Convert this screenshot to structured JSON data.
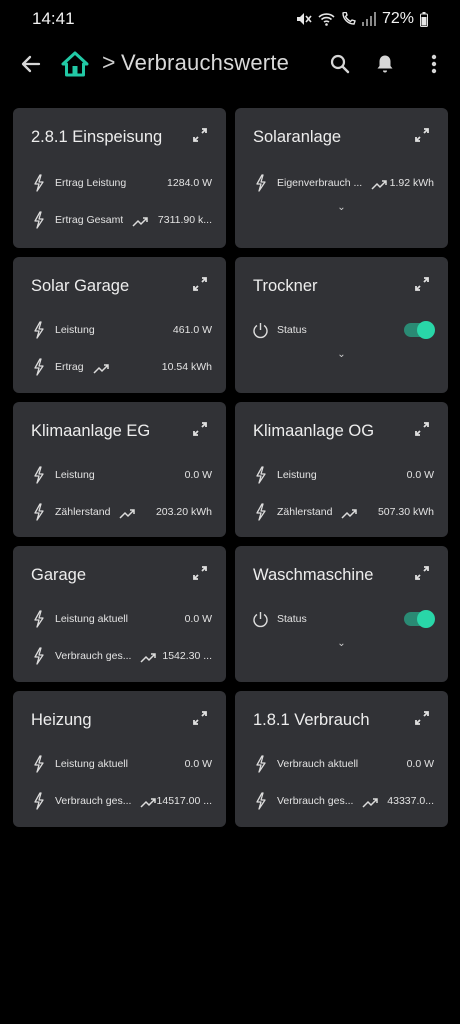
{
  "status_bar": {
    "time": "14:41",
    "battery": "72%"
  },
  "app_bar": {
    "separator": ">",
    "title": "Verbrauchswerte"
  },
  "colors": {
    "accent": "#29d6a8",
    "card": "#313236",
    "background": "#000000"
  },
  "cards": {
    "einspeisung": {
      "title": "2.8.1 Einspeisung",
      "rows": [
        {
          "label": "Ertrag Leistung",
          "value": "1284.0 W"
        },
        {
          "label": "Ertrag Gesamt",
          "value": "7311.90 k..."
        }
      ]
    },
    "solaranlage": {
      "title": "Solaranlage",
      "rows": [
        {
          "label": "Eigenverbrauch ...",
          "value": "1.92 kWh"
        }
      ],
      "chevron": "⌄"
    },
    "solar_garage": {
      "title": "Solar Garage",
      "rows": [
        {
          "label": "Leistung",
          "value": "461.0 W"
        },
        {
          "label": "Ertrag",
          "value": "10.54 kWh"
        }
      ]
    },
    "trockner": {
      "title": "Trockner",
      "rows": [
        {
          "label": "Status"
        }
      ],
      "chevron": "⌄"
    },
    "klima_eg": {
      "title": "Klimaanlage EG",
      "rows": [
        {
          "label": "Leistung",
          "value": "0.0 W"
        },
        {
          "label": "Zählerstand",
          "value": "203.20 kWh"
        }
      ]
    },
    "klima_og": {
      "title": "Klimaanlage OG",
      "rows": [
        {
          "label": "Leistung",
          "value": "0.0 W"
        },
        {
          "label": "Zählerstand",
          "value": "507.30 kWh"
        }
      ]
    },
    "garage": {
      "title": "Garage",
      "rows": [
        {
          "label": "Leistung aktuell",
          "value": "0.0 W"
        },
        {
          "label": "Verbrauch ges...",
          "value": "1542.30 ..."
        }
      ]
    },
    "waschmaschine": {
      "title": "Waschmaschine",
      "rows": [
        {
          "label": "Status"
        }
      ],
      "chevron": "⌄"
    },
    "heizung": {
      "title": "Heizung",
      "rows": [
        {
          "label": "Leistung aktuell",
          "value": "0.0 W"
        },
        {
          "label": "Verbrauch ges...",
          "value": "14517.00 ..."
        }
      ]
    },
    "verbrauch": {
      "title": "1.8.1 Verbrauch",
      "rows": [
        {
          "label": "Verbrauch aktuell",
          "value": "0.0 W"
        },
        {
          "label": "Verbrauch ges...",
          "value": "43337.0..."
        }
      ]
    }
  }
}
